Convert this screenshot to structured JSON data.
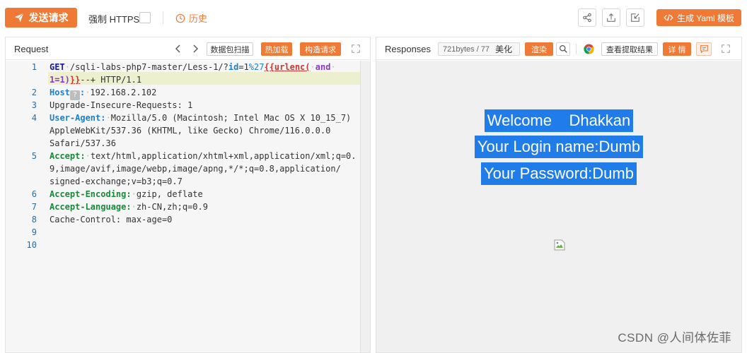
{
  "toolbar": {
    "send_label": "发送请求",
    "https_label": "强制 HTTPS",
    "https_checked": false,
    "history_label": "历史",
    "share_icon": "share-icon",
    "export_icon": "export-icon",
    "import_icon": "import-icon",
    "yaml_label": "生成 Yaml 模板",
    "accent_color": "#ef7a35"
  },
  "request": {
    "title": "Request",
    "scan_label": "数据包扫描",
    "hotload_label": "热加载",
    "construct_label": "构造请求",
    "line_numbers": [
      "1",
      "",
      "2",
      "3",
      "4",
      "",
      "",
      "5",
      "",
      "",
      "6",
      "7",
      "8",
      "9",
      "10"
    ],
    "lines": {
      "l1_method": "GET",
      "l1_path": "/sqli-labs-php7-master/Less-1/?",
      "l1_param": "id",
      "l1_eq": "=1",
      "l1_pct": "%27",
      "l1_tpl_open": "{{urlenc(",
      "l1_and": "and",
      "l2_cond": "1=1)",
      "l2_tpl_close": "}}",
      "l2_rest": "--+ HTTP/1.1",
      "host_key": "Host",
      "host_val": "192.168.2.102",
      "upgrade": "Upgrade-Insecure-Requests: 1",
      "ua_key": "User-Agent:",
      "ua_val1": "Mozilla/5.0 (Macintosh; Intel Mac OS X 10_15_7)",
      "ua_val2": "AppleWebKit/537.36 (KHTML, like Gecko) Chrome/116.0.0.0",
      "ua_val3": "Safari/537.36",
      "accept_key": "Accept:",
      "accept_val1": "text/html,application/xhtml+xml,application/xml;q=0.",
      "accept_val2": "9,image/avif,image/webp,image/apng,*/*;q=0.8,application/",
      "accept_val3": "signed-exchange;v=b3;q=0.7",
      "enc_key": "Accept-Encoding:",
      "enc_val": "gzip, deflate",
      "lang_key": "Accept-Language:",
      "lang_val": "zh-CN,zh;q=0.9",
      "cache": "Cache-Control: max-age=0"
    }
  },
  "response": {
    "title": "Responses",
    "bytes": "721bytes / 77",
    "beautify_label": "美化",
    "render_label": "渲染",
    "extract_label": "查看提取结果",
    "detail_label": "详 情",
    "welcome": "Welcome    Dhakkan",
    "login": "Your Login name:Dumb",
    "password": "Your Password:Dumb",
    "highlight_color": "#1f7ce8",
    "watermark": "CSDN @人间体佐菲"
  }
}
